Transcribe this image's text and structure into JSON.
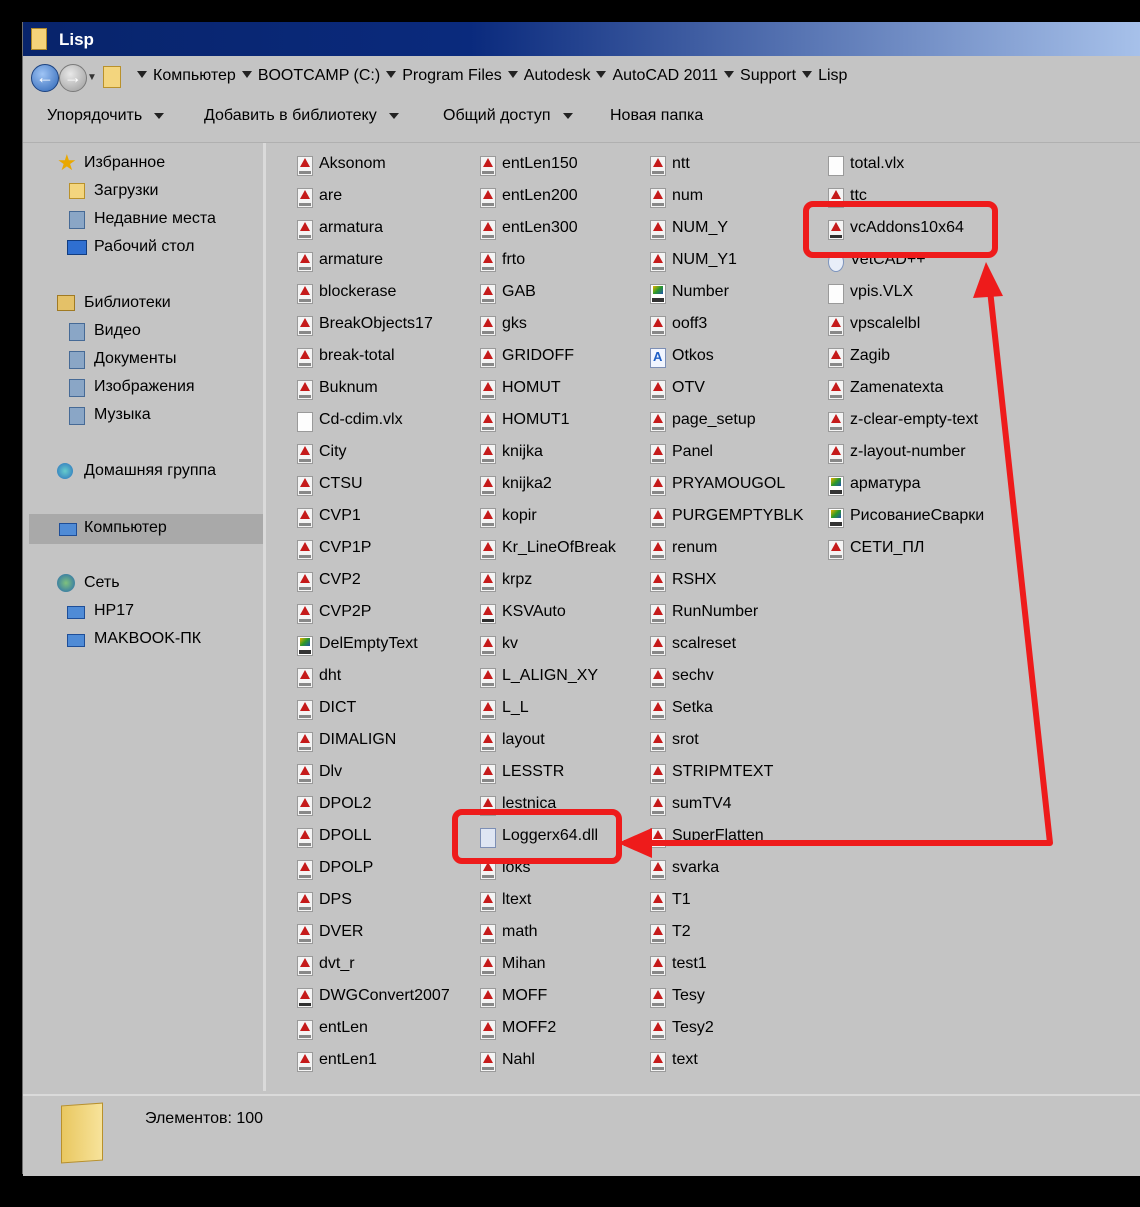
{
  "window": {
    "title": "Lisp"
  },
  "address": {
    "back_glyph": "←",
    "forward_glyph": "→",
    "crumbs": [
      "Компьютер",
      "BOOTCAMP (C:)",
      "Program Files",
      "Autodesk",
      "AutoCAD 2011",
      "Support",
      "Lisp"
    ]
  },
  "toolbar": {
    "organize": "Упорядочить",
    "add_to_library": "Добавить в библиотеку",
    "share": "Общий доступ",
    "new_folder": "Новая папка"
  },
  "nav": {
    "favorites": "Избранное",
    "downloads": "Загрузки",
    "recent": "Недавние места",
    "desktop": "Рабочий стол",
    "libraries": "Библиотеки",
    "video": "Видео",
    "documents": "Документы",
    "images": "Изображения",
    "music": "Музыка",
    "homegroup": "Домашняя группа",
    "computer": "Компьютер",
    "network": "Сеть",
    "net1": "HP17",
    "net2": "MAKBOOK-ПК"
  },
  "files": [
    [
      "Aksonom",
      "are",
      "armatura",
      "armature",
      "blockerase",
      "BreakObjects17",
      "break-total",
      "Buknum",
      "Cd-cdim.vlx",
      "City",
      "CTSU",
      "CVP1",
      "CVP1P",
      "CVP2",
      "CVP2P",
      "DelEmptyText",
      "dht",
      "DICT",
      "DIMALIGN",
      "Dlv",
      "DPOL2",
      "DPOLL",
      "DPOLP",
      "DPS",
      "DVER",
      "dvt_r",
      "DWGConvert2007",
      "entLen",
      "entLen1"
    ],
    [
      "entLen150",
      "entLen200",
      "entLen300",
      "frto",
      "GAB",
      "gks",
      "GRIDOFF",
      "HOMUT",
      "HOMUT1",
      "knijka",
      "knijka2",
      "kopir",
      "Kr_LineOfBreak",
      "krpz",
      "KSVAuto",
      "kv",
      "L_ALIGN_XY",
      "L_L",
      "layout",
      "LESSTR",
      "lestnica",
      "Loggerx64.dll",
      "loks",
      "ltext",
      "math",
      "Mihan",
      "MOFF",
      "MOFF2",
      "Nahl"
    ],
    [
      "ntt",
      "num",
      "NUM_Y",
      "NUM_Y1",
      "Number",
      "ooff3",
      "Otkos",
      "OTV",
      "page_setup",
      "Panel",
      "PRYAMOUGOL",
      "PURGEMPTYBLK",
      "renum",
      "RSHX",
      "RunNumber",
      "scalreset",
      "sechv",
      "Setka",
      "srot",
      "STRIPMTEXT",
      "sumTV4",
      "SuperFlatten",
      "svarka",
      "T1",
      "T2",
      "test1",
      "Tesy",
      "Tesy2",
      "text"
    ],
    [
      "total.vlx",
      "ttc",
      "vcAddons10x64",
      "VetCAD++",
      "vpis.VLX",
      "vpscalelbl",
      "Zagib",
      "Zamenatexta",
      "z-clear-empty-text",
      "z-layout-number",
      "арматура",
      "РисованиеСварки",
      "СЕТИ_ПЛ"
    ]
  ],
  "file_types": [
    [
      "lsp",
      "lsp",
      "lsp",
      "lsp",
      "lsp",
      "lsp",
      "lsp",
      "lsp",
      "vlx",
      "lsp",
      "lsp",
      "lsp",
      "lsp",
      "lsp",
      "lsp",
      "dvb",
      "lsp",
      "lsp",
      "lsp",
      "lsp",
      "lsp",
      "lsp",
      "lsp",
      "lsp",
      "lsp",
      "lsp",
      "arx",
      "lsp",
      "lsp"
    ],
    [
      "lsp",
      "lsp",
      "lsp",
      "lsp",
      "lsp",
      "lsp",
      "lsp",
      "lsp",
      "lsp",
      "lsp",
      "lsp",
      "lsp",
      "lsp",
      "lsp",
      "arx",
      "lsp",
      "lsp",
      "lsp",
      "lsp",
      "lsp",
      "lsp",
      "dll",
      "lsp",
      "lsp",
      "lsp",
      "lsp",
      "lsp",
      "lsp",
      "lsp"
    ],
    [
      "lsp",
      "lsp",
      "lsp",
      "lsp",
      "dvb",
      "lsp",
      "app",
      "lsp",
      "lsp",
      "lsp",
      "lsp",
      "lsp",
      "lsp",
      "lsp",
      "lsp",
      "lsp",
      "lsp",
      "lsp",
      "lsp",
      "lsp",
      "lsp",
      "lsp",
      "lsp",
      "lsp",
      "lsp",
      "lsp",
      "lsp",
      "lsp",
      "lsp"
    ],
    [
      "vlx",
      "lsp",
      "arx",
      "cfg",
      "vlx",
      "lsp",
      "lsp",
      "lsp",
      "lsp",
      "lsp",
      "dvb",
      "dvb",
      "lsp"
    ]
  ],
  "status": {
    "count_text": "Элементов: 100"
  },
  "annotation": {
    "color": "#ee1b1b"
  }
}
